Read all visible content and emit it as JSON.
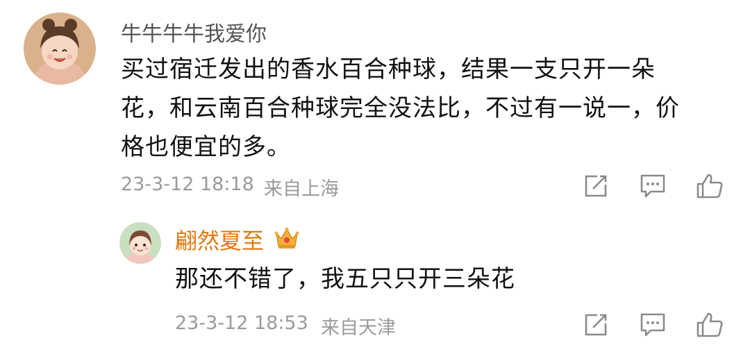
{
  "comment": {
    "username": "牛牛牛牛我爱你",
    "avatar_icon": "girl-avatar",
    "text": "买过宿迁发出的香水百合种球，结果一支只开一朵花，和云南百合种球完全没法比，不过有一说一，价格也便宜的多。",
    "timestamp": "23-3-12 18:18",
    "location": "来自上海",
    "actions": [
      "share-icon",
      "comment-icon",
      "like-icon"
    ]
  },
  "reply": {
    "username": "翩然夏至",
    "badge_icon": "crown-icon",
    "avatar_icon": "girl-avatar-small",
    "text": "那还不错了，我五只只开三朵花",
    "timestamp": "23-3-12 18:53",
    "location": "来自天津",
    "actions": [
      "share-icon",
      "comment-icon",
      "like-icon"
    ]
  },
  "colors": {
    "username_primary": "#555555",
    "username_reply": "#e0780f",
    "meta_text": "#9a9a9a",
    "icon_gray": "#8a8a8a"
  }
}
